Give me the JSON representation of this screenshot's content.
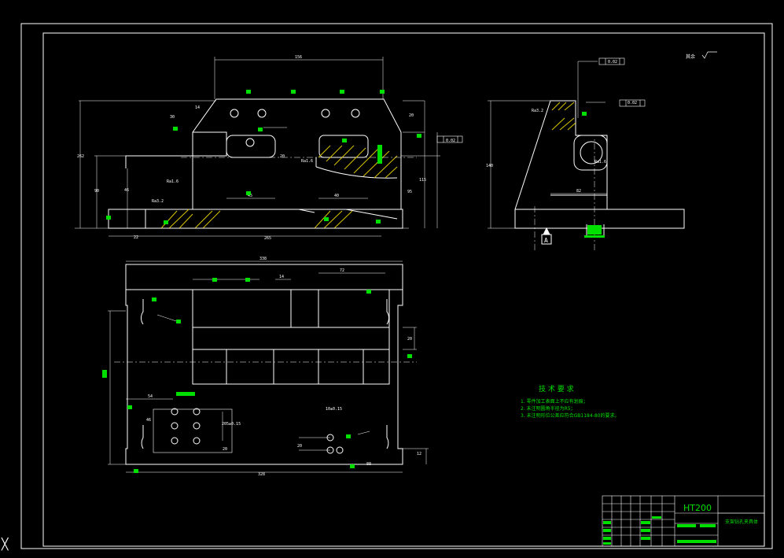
{
  "sheet": {
    "title_block": {
      "material": "HT200",
      "part_name": "支架钻孔夹具体"
    },
    "roughness_note": "其余",
    "tech_requirements": {
      "heading": "技 术 要 求",
      "items": [
        "1. 零件加工表面上不应有划痕；",
        "2. 未注明圆角半径为R5；",
        "3. 未注明形位公差应符合GB1184-80的要求。"
      ]
    },
    "front_view": {
      "dims": [
        "156",
        "14",
        "30",
        "20",
        "265",
        "45",
        "20",
        "90",
        "40",
        "22",
        "262",
        "115",
        "95",
        "46"
      ],
      "roughness": [
        "Ra3.2",
        "Ra1.6",
        "Ra1.6"
      ],
      "tolerance": "0.02"
    },
    "side_view": {
      "dims": [
        "140",
        "82"
      ],
      "roughness": [
        "Ra3.2",
        "Ra1.6"
      ],
      "tolerances": [
        "0.02",
        "0.02"
      ],
      "datum": "A"
    },
    "top_view": {
      "dims": [
        "338",
        "14",
        "72",
        "20",
        "54",
        "46",
        "205±0.15",
        "20",
        "328",
        "10±0.15",
        "20",
        "88",
        "12"
      ]
    }
  }
}
